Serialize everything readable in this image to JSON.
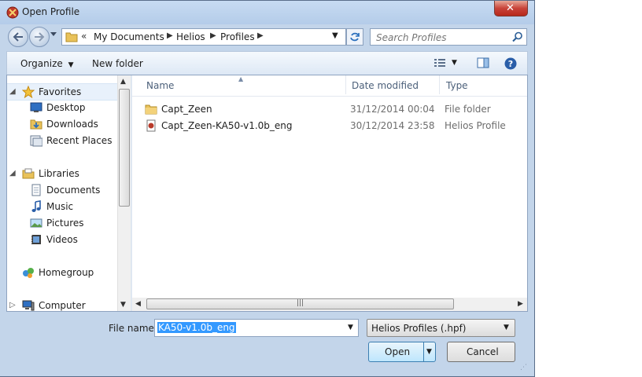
{
  "window": {
    "title": "Open Profile"
  },
  "address": {
    "overflow": "«",
    "crumbs": [
      "My Documents",
      "Helios",
      "Profiles"
    ]
  },
  "search": {
    "placeholder": "Search Profiles"
  },
  "toolbar": {
    "organize_label": "Organize",
    "new_folder_label": "New folder"
  },
  "nav": {
    "items": [
      {
        "label": "Favorites",
        "icon": "star-icon"
      },
      {
        "label": "Desktop",
        "icon": "desktop-icon"
      },
      {
        "label": "Downloads",
        "icon": "downloads-folder-icon"
      },
      {
        "label": "Recent Places",
        "icon": "recent-places-icon"
      },
      {
        "label": "Libraries",
        "icon": "libraries-icon"
      },
      {
        "label": "Documents",
        "icon": "documents-icon"
      },
      {
        "label": "Music",
        "icon": "music-icon"
      },
      {
        "label": "Pictures",
        "icon": "pictures-icon"
      },
      {
        "label": "Videos",
        "icon": "videos-icon"
      },
      {
        "label": "Homegroup",
        "icon": "homegroup-icon"
      },
      {
        "label": "Computer",
        "icon": "computer-icon"
      }
    ]
  },
  "files": {
    "columns": [
      "Name",
      "Date modified",
      "Type"
    ],
    "rows": [
      {
        "name": "Capt_Zeen",
        "date": "31/12/2014 00:04",
        "type": "File folder",
        "icon": "folder-icon"
      },
      {
        "name": "Capt_Zeen-KA50-v1.0b_eng",
        "date": "30/12/2014 23:58",
        "type": "Helios Profile",
        "icon": "helios-profile-icon"
      }
    ]
  },
  "footer": {
    "file_name_label": "File name:",
    "file_name_value": "KA50-v1.0b_eng",
    "file_type_value": "Helios Profiles (.hpf)",
    "open_label": "Open",
    "cancel_label": "Cancel"
  },
  "colors": {
    "accent": "#3399ff",
    "close_button": "#c8443a",
    "frame": "#c3d5ea"
  }
}
